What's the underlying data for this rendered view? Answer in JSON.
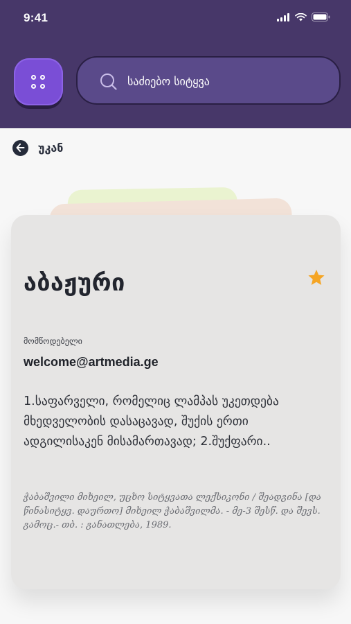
{
  "status_bar": {
    "time": "9:41"
  },
  "header": {
    "search": {
      "placeholder": "საძიებო სიტყვა"
    }
  },
  "nav": {
    "back_label": "უკან"
  },
  "entry": {
    "word": "აბაჟური",
    "supplier_label": "მომწოდებელი",
    "supplier_email": "welcome@artmedia.ge",
    "definition": "1.საფარველი, რომელიც ლამპას უკეთდება მხედველობის დასაცავად, შუქის ერთი ადგილისაკენ მისამართავად; 2.შუქფარი..",
    "source": "ჭაბაშვილი მიხეილ, უცხო სიტყვათა ლექსიკონი / შეადგინა [და წინასიტყვ. დაურთო] მიხეილ ჭაბაშვილმა. - მე-3 შესწ. და შევს. გამოც.- თბ. : განათლება, 1989.",
    "favorite": true
  },
  "colors": {
    "header_bg": "#473769",
    "menu_button": "#7a4ed6",
    "search_bg": "#5a4a8a",
    "card_bg": "#e6e5e4",
    "star": "#f5a524"
  },
  "icons": {
    "menu": "grid-dots-icon",
    "search": "search-icon",
    "back": "arrow-left-icon",
    "favorite": "star-icon"
  }
}
